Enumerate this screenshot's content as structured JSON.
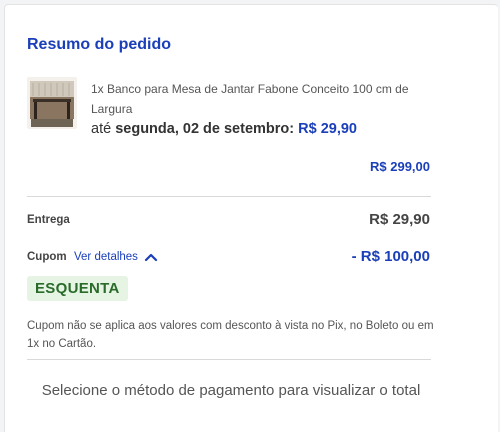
{
  "summary": {
    "title": "Resumo do pedido"
  },
  "item": {
    "name": "1x Banco para Mesa de Jantar Fabone Conceito 100 cm de Largura",
    "delivery_prefix": "até",
    "delivery_date": "segunda, 02 de setembro:",
    "delivery_price": "R$ 29,90",
    "subtotal": "R$ 299,00"
  },
  "shipping": {
    "label": "Entrega",
    "value": "R$ 29,90"
  },
  "coupon": {
    "label": "Cupom",
    "details_link": "Ver detalhes",
    "value": "- R$ 100,00",
    "code": "ESQUENTA",
    "note": "Cupom não se aplica aos valores com desconto à vista no Pix, no Boleto ou em 1x no Cartão."
  },
  "footer": {
    "message": "Selecione o método de pagamento para visualizar o total"
  },
  "colors": {
    "brand_blue": "#1a3fb8",
    "text_dark": "#333333",
    "coupon_green_bg": "#e6f4e4",
    "coupon_green_text": "#2a6b2a"
  }
}
